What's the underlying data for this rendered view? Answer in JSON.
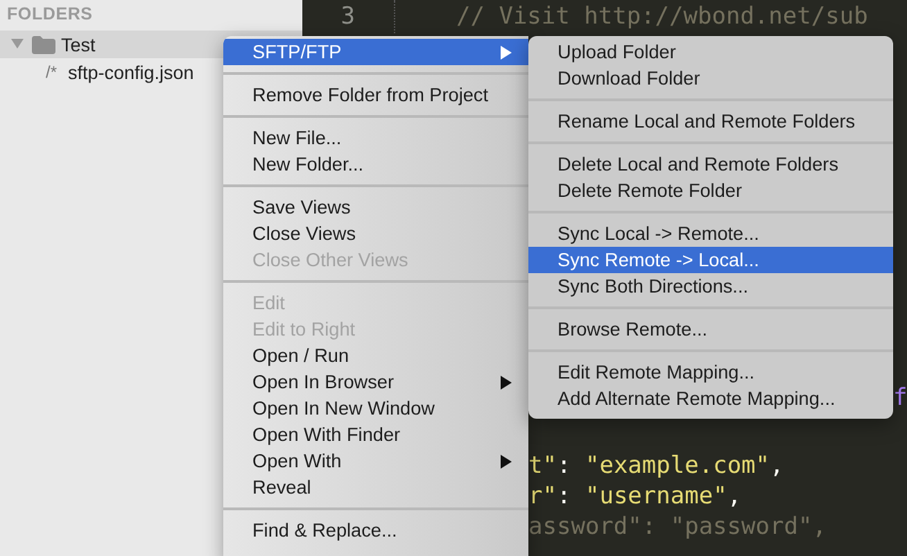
{
  "sidebar": {
    "header": "FOLDERS",
    "folders": [
      {
        "name": "Test",
        "expanded": true,
        "selected": true,
        "children": [
          {
            "icon_text": "/*",
            "name": "sftp-config.json",
            "selected": false
          }
        ]
      }
    ]
  },
  "editor": {
    "gutter_line": "3",
    "first_line": [
      {
        "text": "// Visit http://wbond.net/sub",
        "kind": "comment"
      }
    ],
    "lines": [
      [
        {
          "text": "f",
          "kind": "constant"
        }
      ],
      [
        {
          "text": "t\"",
          "kind": "string"
        },
        {
          "text": ": ",
          "kind": "plain"
        },
        {
          "text": "\"example.com\"",
          "kind": "string"
        },
        {
          "text": ",",
          "kind": "plain"
        }
      ],
      [
        {
          "text": "r\"",
          "kind": "string"
        },
        {
          "text": ": ",
          "kind": "plain"
        },
        {
          "text": "\"username\"",
          "kind": "string"
        },
        {
          "text": ",",
          "kind": "plain"
        }
      ],
      [
        {
          "text": "assword\": \"password\",",
          "kind": "comment"
        }
      ]
    ]
  },
  "context_menu": {
    "items": [
      {
        "kind": "item",
        "label": "SFTP/FTP",
        "submenu": true,
        "selected": true,
        "disabled": false
      },
      {
        "kind": "separator"
      },
      {
        "kind": "item",
        "label": "Remove Folder from Project",
        "submenu": false,
        "selected": false,
        "disabled": false
      },
      {
        "kind": "separator"
      },
      {
        "kind": "item",
        "label": "New File...",
        "submenu": false,
        "selected": false,
        "disabled": false
      },
      {
        "kind": "item",
        "label": "New Folder...",
        "submenu": false,
        "selected": false,
        "disabled": false
      },
      {
        "kind": "separator"
      },
      {
        "kind": "item",
        "label": "Save Views",
        "submenu": false,
        "selected": false,
        "disabled": false
      },
      {
        "kind": "item",
        "label": "Close Views",
        "submenu": false,
        "selected": false,
        "disabled": false
      },
      {
        "kind": "item",
        "label": "Close Other Views",
        "submenu": false,
        "selected": false,
        "disabled": true
      },
      {
        "kind": "separator"
      },
      {
        "kind": "item",
        "label": "Edit",
        "submenu": false,
        "selected": false,
        "disabled": true
      },
      {
        "kind": "item",
        "label": "Edit to Right",
        "submenu": false,
        "selected": false,
        "disabled": true
      },
      {
        "kind": "item",
        "label": "Open / Run",
        "submenu": false,
        "selected": false,
        "disabled": false
      },
      {
        "kind": "item",
        "label": "Open In Browser",
        "submenu": true,
        "selected": false,
        "disabled": false
      },
      {
        "kind": "item",
        "label": "Open In New Window",
        "submenu": false,
        "selected": false,
        "disabled": false
      },
      {
        "kind": "item",
        "label": "Open With Finder",
        "submenu": false,
        "selected": false,
        "disabled": false
      },
      {
        "kind": "item",
        "label": "Open With",
        "submenu": true,
        "selected": false,
        "disabled": false
      },
      {
        "kind": "item",
        "label": "Reveal",
        "submenu": false,
        "selected": false,
        "disabled": false
      },
      {
        "kind": "separator"
      },
      {
        "kind": "item",
        "label": "Find & Replace...",
        "submenu": false,
        "selected": false,
        "disabled": false
      }
    ]
  },
  "submenu": {
    "items": [
      {
        "kind": "item",
        "label": "Upload Folder",
        "submenu": false,
        "selected": false,
        "disabled": false
      },
      {
        "kind": "item",
        "label": "Download Folder",
        "submenu": false,
        "selected": false,
        "disabled": false
      },
      {
        "kind": "separator"
      },
      {
        "kind": "item",
        "label": "Rename Local and Remote Folders",
        "submenu": false,
        "selected": false,
        "disabled": false
      },
      {
        "kind": "separator"
      },
      {
        "kind": "item",
        "label": "Delete Local and Remote Folders",
        "submenu": false,
        "selected": false,
        "disabled": false
      },
      {
        "kind": "item",
        "label": "Delete Remote Folder",
        "submenu": false,
        "selected": false,
        "disabled": false
      },
      {
        "kind": "separator"
      },
      {
        "kind": "item",
        "label": "Sync Local -> Remote...",
        "submenu": false,
        "selected": false,
        "disabled": false
      },
      {
        "kind": "item",
        "label": "Sync Remote -> Local...",
        "submenu": false,
        "selected": true,
        "disabled": false
      },
      {
        "kind": "item",
        "label": "Sync Both Directions...",
        "submenu": false,
        "selected": false,
        "disabled": false
      },
      {
        "kind": "separator"
      },
      {
        "kind": "item",
        "label": "Browse Remote...",
        "submenu": false,
        "selected": false,
        "disabled": false
      },
      {
        "kind": "separator"
      },
      {
        "kind": "item",
        "label": "Edit Remote Mapping...",
        "submenu": false,
        "selected": false,
        "disabled": false
      },
      {
        "kind": "item",
        "label": "Add Alternate Remote Mapping...",
        "submenu": false,
        "selected": false,
        "disabled": false
      }
    ]
  }
}
